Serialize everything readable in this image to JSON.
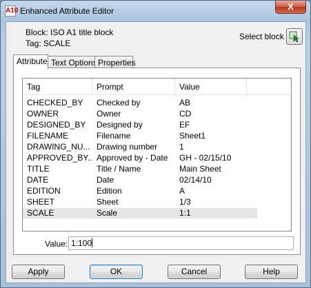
{
  "window": {
    "title": "Enhanced Attribute Editor",
    "app_icon": "A10",
    "close_label": "X"
  },
  "info": {
    "block_line": "Block: ISO A1 title block",
    "tag_line": "Tag: SCALE"
  },
  "select_block": {
    "label": "Select block",
    "icon": "select-objects-icon"
  },
  "tabs": [
    {
      "label": "Attribute",
      "active": true
    },
    {
      "label": "Text Options",
      "active": false
    },
    {
      "label": "Properties",
      "active": false
    }
  ],
  "table": {
    "columns": [
      "Tag",
      "Prompt",
      "Value"
    ],
    "rows": [
      {
        "tag": "CHECKED_BY",
        "prompt": "Checked by",
        "value": "AB"
      },
      {
        "tag": "OWNER",
        "prompt": "Owner",
        "value": "CD"
      },
      {
        "tag": "DESIGNED_BY",
        "prompt": "Designed by",
        "value": "EF"
      },
      {
        "tag": "FILENAME",
        "prompt": "Filename",
        "value": "Sheet1"
      },
      {
        "tag": "DRAWING_NU...",
        "prompt": "Drawing number",
        "value": "1"
      },
      {
        "tag": "APPROVED_BY...",
        "prompt": "Approved by - Date",
        "value": "GH - 02/15/10"
      },
      {
        "tag": "TITLE",
        "prompt": "Title / Name",
        "value": "Main Sheet"
      },
      {
        "tag": "DATE",
        "prompt": "Date",
        "value": "02/14/10"
      },
      {
        "tag": "EDITION",
        "prompt": "Edition",
        "value": "A"
      },
      {
        "tag": "SHEET",
        "prompt": "Sheet",
        "value": "1/3"
      },
      {
        "tag": "SCALE",
        "prompt": "Scale",
        "value": "1:1"
      }
    ],
    "selected_row": 10
  },
  "value_field": {
    "label": "Value:",
    "value": "1:100"
  },
  "buttons": {
    "apply": "Apply",
    "ok": "OK",
    "cancel": "Cancel",
    "help": "Help"
  }
}
